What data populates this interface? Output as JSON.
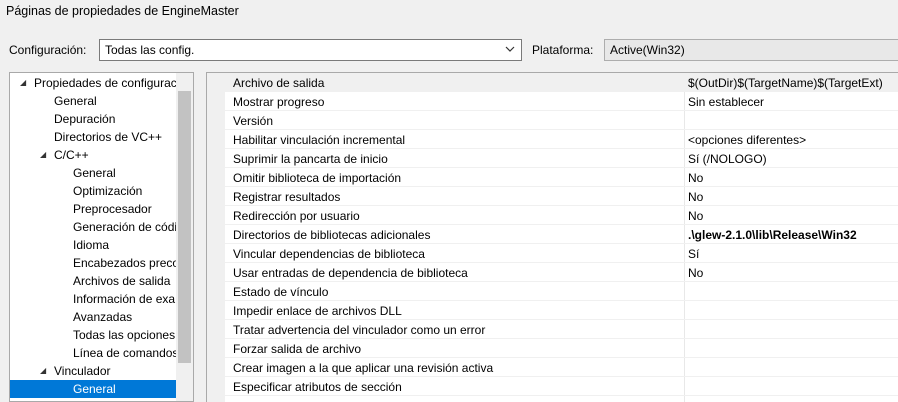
{
  "window": {
    "title": "Páginas de propiedades de EngineMaster"
  },
  "config": {
    "label": "Configuración:",
    "value": "Todas las config.",
    "dropdown_icon": "chevron-down-icon"
  },
  "platform": {
    "label": "Plataforma:",
    "value": "Active(Win32)"
  },
  "tree": {
    "items": [
      {
        "label": "Propiedades de configurac",
        "level": 0,
        "expanded": true
      },
      {
        "label": "General",
        "level": 1
      },
      {
        "label": "Depuración",
        "level": 1
      },
      {
        "label": "Directorios de VC++",
        "level": 1
      },
      {
        "label": "C/C++",
        "level": 1,
        "expanded": true
      },
      {
        "label": "General",
        "level": 2
      },
      {
        "label": "Optimización",
        "level": 2
      },
      {
        "label": "Preprocesador",
        "level": 2
      },
      {
        "label": "Generación de códi",
        "level": 2
      },
      {
        "label": "Idioma",
        "level": 2
      },
      {
        "label": "Encabezados precor",
        "level": 2
      },
      {
        "label": "Archivos de salida",
        "level": 2
      },
      {
        "label": "Información de exa",
        "level": 2
      },
      {
        "label": "Avanzadas",
        "level": 2
      },
      {
        "label": "Todas las opciones",
        "level": 2
      },
      {
        "label": "Línea de comandos",
        "level": 2
      },
      {
        "label": "Vinculador",
        "level": 1,
        "expanded": true
      },
      {
        "label": "General",
        "level": 2,
        "selected": true
      }
    ]
  },
  "properties": [
    {
      "name": "Archivo de salida",
      "value": "$(OutDir)$(TargetName)$(TargetExt)"
    },
    {
      "name": "Mostrar progreso",
      "value": "Sin establecer"
    },
    {
      "name": "Versión",
      "value": ""
    },
    {
      "name": "Habilitar vinculación incremental",
      "value": "<opciones diferentes>"
    },
    {
      "name": "Suprimir la pancarta de inicio",
      "value": "Sí (/NOLOGO)"
    },
    {
      "name": "Omitir biblioteca de importación",
      "value": "No"
    },
    {
      "name": "Registrar resultados",
      "value": "No"
    },
    {
      "name": "Redirección por usuario",
      "value": "No"
    },
    {
      "name": "Directorios de bibliotecas adicionales",
      "value": ".\\glew-2.1.0\\lib\\Release\\Win32",
      "bold": true
    },
    {
      "name": "Vincular dependencias de biblioteca",
      "value": "Sí"
    },
    {
      "name": "Usar entradas de dependencia de biblioteca",
      "value": "No"
    },
    {
      "name": "Estado de vínculo",
      "value": ""
    },
    {
      "name": "Impedir enlace de archivos DLL",
      "value": ""
    },
    {
      "name": "Tratar advertencia del vinculador como un error",
      "value": ""
    },
    {
      "name": "Forzar salida de archivo",
      "value": ""
    },
    {
      "name": "Crear imagen a la que aplicar una revisión activa",
      "value": ""
    },
    {
      "name": "Especificar atributos de sección",
      "value": ""
    }
  ],
  "colors": {
    "selection": "#0078d7",
    "background": "#f0f0f0"
  }
}
